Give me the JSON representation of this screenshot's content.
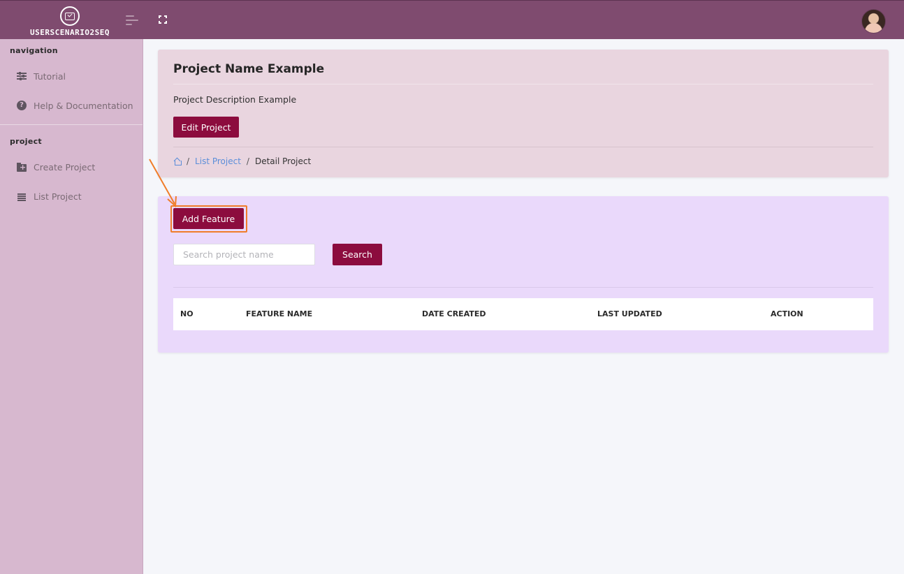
{
  "header": {
    "brand_name": "USERSCENARIO2SEQ",
    "brand_icon": "check-screen-icon",
    "menu_icon": "hamburger-icon",
    "fullscreen_icon": "expand-icon"
  },
  "sidebar": {
    "sections": [
      {
        "title": "navigation",
        "items": [
          {
            "label": "Tutorial",
            "icon": "sliders-icon"
          },
          {
            "label": "Help & Documentation",
            "icon": "help-icon"
          }
        ]
      },
      {
        "title": "project",
        "items": [
          {
            "label": "Create Project",
            "icon": "folder-plus-icon"
          },
          {
            "label": "List Project",
            "icon": "list-icon"
          }
        ]
      }
    ]
  },
  "project": {
    "title": "Project Name Example",
    "description": "Project Description Example",
    "edit_label": "Edit Project"
  },
  "breadcrumb": {
    "home_icon": "home-icon",
    "separator": "/",
    "link": "List Project",
    "current": "Detail Project"
  },
  "features": {
    "add_label": "Add Feature",
    "search": {
      "placeholder": "Search project name",
      "value": "",
      "button_label": "Search"
    },
    "table": {
      "columns": [
        "NO",
        "FEATURE NAME",
        "DATE CREATED",
        "LAST UPDATED",
        "ACTION"
      ],
      "rows": []
    }
  },
  "colors": {
    "topbar": "#7f4b6f",
    "sidebar": "#d7b8cf",
    "primary_button": "#8c0c3e",
    "project_card": "#e9d5df",
    "feature_card": "#ead9fb",
    "highlight": "#f07d2a",
    "link": "#5b8ed9"
  }
}
